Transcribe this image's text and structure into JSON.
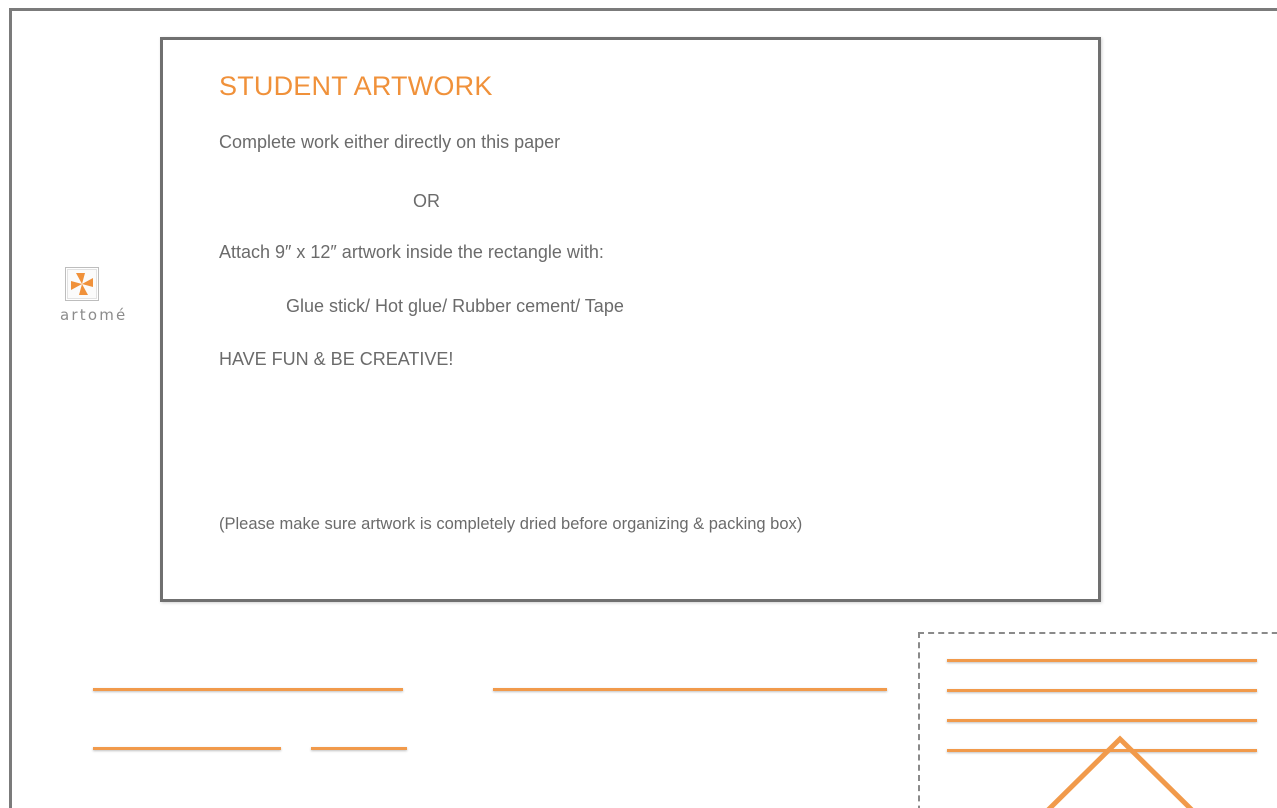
{
  "card": {
    "title": "STUDENT ARTWORK",
    "line_1": "Complete work either directly on this paper",
    "or_text": "OR",
    "line_2": "Attach 9″ x 12″ artwork inside the rectangle with:",
    "line_3": "Glue stick/ Hot glue/ Rubber cement/ Tape",
    "line_4": "HAVE FUN & BE CREATIVE!",
    "note": "(Please make sure artwork is completely dried before organizing & packing box)"
  },
  "logo": {
    "wordmark": "artomé",
    "icon": "pinwheel-logo-icon"
  },
  "colors": {
    "accent": "#f0913a",
    "rule": "#f19a4b",
    "text": "#6b6b6b",
    "border": "#707070"
  }
}
